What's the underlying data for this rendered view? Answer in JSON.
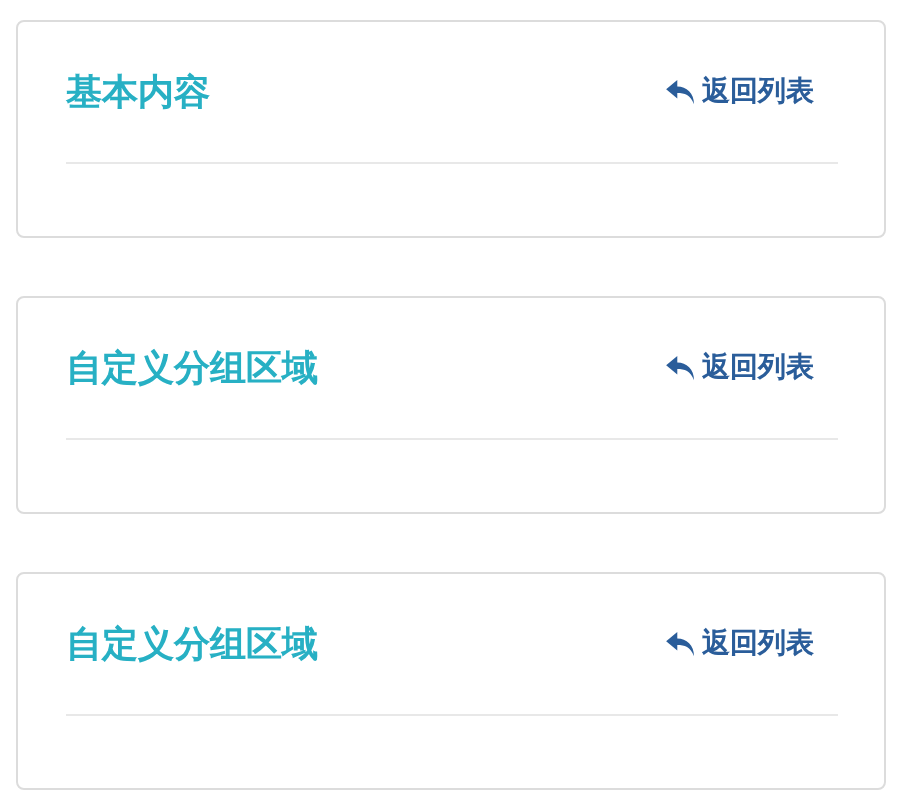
{
  "panels": [
    {
      "title": "基本内容",
      "back_link": "返回列表"
    },
    {
      "title": "自定义分组区域",
      "back_link": "返回列表"
    },
    {
      "title": "自定义分组区域",
      "back_link": "返回列表"
    }
  ]
}
